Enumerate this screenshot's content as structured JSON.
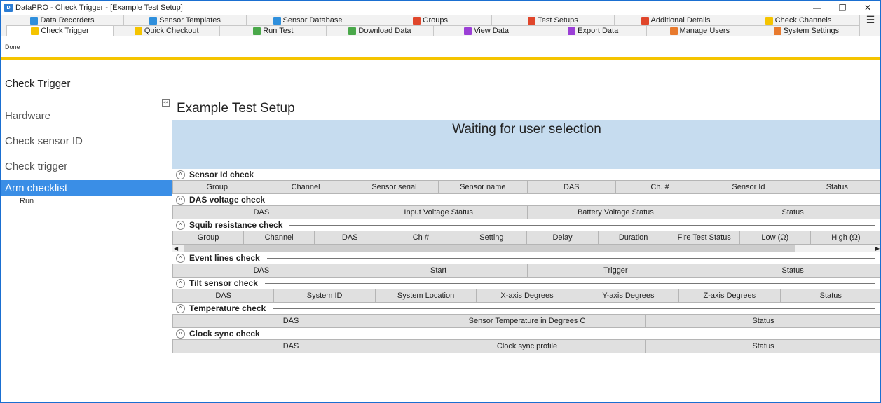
{
  "window": {
    "title": "DataPRO - Check Trigger - [Example Test Setup]"
  },
  "tabs_row1": [
    {
      "label": "Data Recorders",
      "color": "#2f8fdc"
    },
    {
      "label": "Sensor Templates",
      "color": "#2f8fdc"
    },
    {
      "label": "Sensor Database",
      "color": "#2f8fdc"
    },
    {
      "label": "Groups",
      "color": "#e0462b"
    },
    {
      "label": "Test Setups",
      "color": "#e0462b"
    },
    {
      "label": "Additional Details",
      "color": "#e0462b"
    },
    {
      "label": "Check Channels",
      "color": "#f5c400"
    }
  ],
  "tabs_row2": [
    {
      "label": "Check Trigger",
      "color": "#f5c400"
    },
    {
      "label": "Quick Checkout",
      "color": "#f5c400"
    },
    {
      "label": "Run Test",
      "color": "#4aa84a"
    },
    {
      "label": "Download Data",
      "color": "#4aa84a"
    },
    {
      "label": "View Data",
      "color": "#9b3fd6"
    },
    {
      "label": "Export Data",
      "color": "#9b3fd6"
    },
    {
      "label": "Manage Users",
      "color": "#e87a2e"
    },
    {
      "label": "System Settings",
      "color": "#e87a2e"
    }
  ],
  "toolbar": {
    "done_label": "Done"
  },
  "nav": {
    "heading": "Check Trigger",
    "items": [
      "Hardware",
      "Check sensor ID",
      "Check trigger",
      "Arm checklist"
    ],
    "sub": "Run"
  },
  "main": {
    "setup_title": "Example Test Setup",
    "waiting": "Waiting for user selection",
    "collapse_label": "<<"
  },
  "sections": [
    {
      "title": "Sensor Id check",
      "cols": [
        "Group",
        "Channel",
        "Sensor serial",
        "Sensor name",
        "DAS",
        "Ch. #",
        "Sensor Id",
        "Status"
      ]
    },
    {
      "title": "DAS voltage check",
      "cols": [
        "DAS",
        "Input Voltage Status",
        "Battery Voltage Status",
        "Status"
      ]
    },
    {
      "title": "Squib resistance check",
      "cols": [
        "Group",
        "Channel",
        "DAS",
        "Ch #",
        "Setting",
        "Delay",
        "Duration",
        "Fire Test Status",
        "Low (Ω)",
        "High (Ω)"
      ]
    },
    {
      "title": "Event lines check",
      "cols": [
        "DAS",
        "Start",
        "Trigger",
        "Status"
      ]
    },
    {
      "title": "Tilt sensor check",
      "cols": [
        "DAS",
        "System ID",
        "System Location",
        "X-axis Degrees",
        "Y-axis Degrees",
        "Z-axis Degrees",
        "Status"
      ]
    },
    {
      "title": "Temperature check",
      "cols": [
        "DAS",
        "Sensor Temperature in Degrees C",
        "Status"
      ]
    },
    {
      "title": "Clock sync check",
      "cols": [
        "DAS",
        "Clock sync profile",
        "Status"
      ]
    }
  ]
}
